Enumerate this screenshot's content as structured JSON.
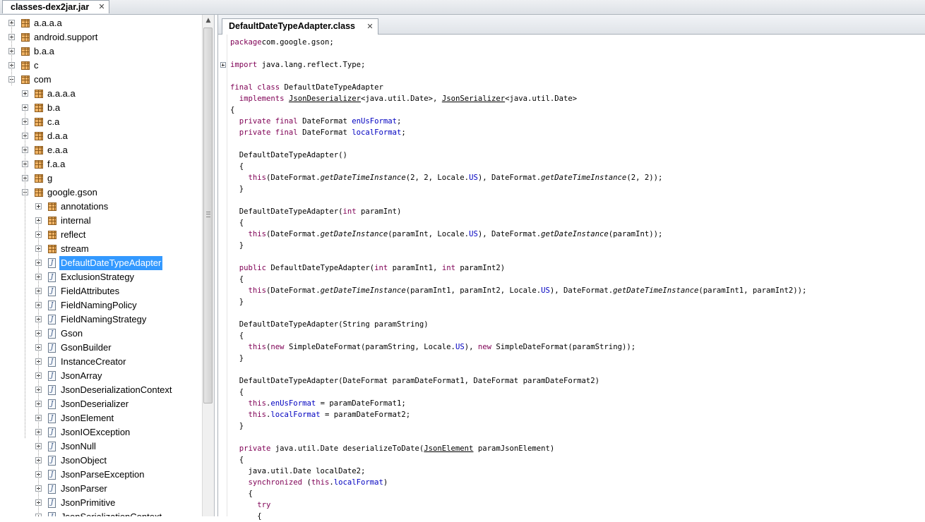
{
  "window": {
    "top_tab": "classes-dex2jar.jar"
  },
  "tree": [
    {
      "label": "a.a.a.a",
      "kind": "package",
      "level": 0,
      "expanded": false
    },
    {
      "label": "android.support",
      "kind": "package",
      "level": 0,
      "expanded": false
    },
    {
      "label": "b.a.a",
      "kind": "package",
      "level": 0,
      "expanded": false
    },
    {
      "label": "c",
      "kind": "package",
      "level": 0,
      "expanded": false
    },
    {
      "label": "com",
      "kind": "package",
      "level": 0,
      "expanded": true
    },
    {
      "label": "a.a.a.a",
      "kind": "package",
      "level": 1,
      "expanded": false
    },
    {
      "label": "b.a",
      "kind": "package",
      "level": 1,
      "expanded": false
    },
    {
      "label": "c.a",
      "kind": "package",
      "level": 1,
      "expanded": false
    },
    {
      "label": "d.a.a",
      "kind": "package",
      "level": 1,
      "expanded": false
    },
    {
      "label": "e.a.a",
      "kind": "package",
      "level": 1,
      "expanded": false
    },
    {
      "label": "f.a.a",
      "kind": "package",
      "level": 1,
      "expanded": false
    },
    {
      "label": "g",
      "kind": "package",
      "level": 1,
      "expanded": false
    },
    {
      "label": "google.gson",
      "kind": "package",
      "level": 1,
      "expanded": true
    },
    {
      "label": "annotations",
      "kind": "package",
      "level": 2,
      "expanded": false
    },
    {
      "label": "internal",
      "kind": "package",
      "level": 2,
      "expanded": false
    },
    {
      "label": "reflect",
      "kind": "package",
      "level": 2,
      "expanded": false
    },
    {
      "label": "stream",
      "kind": "package",
      "level": 2,
      "expanded": false
    },
    {
      "label": "DefaultDateTypeAdapter",
      "kind": "class",
      "level": 2,
      "expanded": false,
      "selected": true
    },
    {
      "label": "ExclusionStrategy",
      "kind": "class",
      "level": 2,
      "expanded": false
    },
    {
      "label": "FieldAttributes",
      "kind": "class",
      "level": 2,
      "expanded": false
    },
    {
      "label": "FieldNamingPolicy",
      "kind": "class",
      "level": 2,
      "expanded": false
    },
    {
      "label": "FieldNamingStrategy",
      "kind": "class",
      "level": 2,
      "expanded": false
    },
    {
      "label": "Gson",
      "kind": "class",
      "level": 2,
      "expanded": false
    },
    {
      "label": "GsonBuilder",
      "kind": "class",
      "level": 2,
      "expanded": false
    },
    {
      "label": "InstanceCreator",
      "kind": "class",
      "level": 2,
      "expanded": false
    },
    {
      "label": "JsonArray",
      "kind": "class",
      "level": 2,
      "expanded": false
    },
    {
      "label": "JsonDeserializationContext",
      "kind": "class",
      "level": 2,
      "expanded": false
    },
    {
      "label": "JsonDeserializer",
      "kind": "class",
      "level": 2,
      "expanded": false
    },
    {
      "label": "JsonElement",
      "kind": "class",
      "level": 2,
      "expanded": false
    },
    {
      "label": "JsonIOException",
      "kind": "class",
      "level": 2,
      "expanded": false
    },
    {
      "label": "JsonNull",
      "kind": "class",
      "level": 2,
      "expanded": false
    },
    {
      "label": "JsonObject",
      "kind": "class",
      "level": 2,
      "expanded": false
    },
    {
      "label": "JsonParseException",
      "kind": "class",
      "level": 2,
      "expanded": false
    },
    {
      "label": "JsonParser",
      "kind": "class",
      "level": 2,
      "expanded": false
    },
    {
      "label": "JsonPrimitive",
      "kind": "class",
      "level": 2,
      "expanded": false
    },
    {
      "label": "JsonSerializationContext",
      "kind": "class",
      "level": 2,
      "expanded": false
    }
  ],
  "editor": {
    "tab_label": "DefaultDateTypeAdapter.class",
    "code_lines": [
      {
        "row": 0,
        "segments": [
          [
            "kw",
            "package"
          ],
          [
            "",
            "com.google.gson;"
          ]
        ]
      },
      {
        "row": 2,
        "fold": true,
        "segments": [
          [
            "kw",
            "import"
          ],
          [
            "",
            " java.lang.reflect.Type;"
          ]
        ]
      },
      {
        "row": 4,
        "segments": [
          [
            "kw",
            "final class"
          ],
          [
            "",
            " DefaultDateTypeAdapter"
          ]
        ]
      },
      {
        "row": 5,
        "segments": [
          [
            "",
            "  "
          ],
          [
            "kw",
            "implements"
          ],
          [
            "",
            " "
          ],
          [
            "typ",
            "JsonDeserializer"
          ],
          [
            "",
            "<java.util.Date>, "
          ],
          [
            "typ",
            "JsonSerializer"
          ],
          [
            "",
            "<java.util.Date>"
          ]
        ]
      },
      {
        "row": 6,
        "segments": [
          [
            "",
            "{"
          ]
        ]
      },
      {
        "row": 7,
        "segments": [
          [
            "",
            "  "
          ],
          [
            "kw",
            "private final"
          ],
          [
            "",
            " DateFormat "
          ],
          [
            "fld",
            "enUsFormat"
          ],
          [
            "",
            ";"
          ]
        ]
      },
      {
        "row": 8,
        "segments": [
          [
            "",
            "  "
          ],
          [
            "kw",
            "private final"
          ],
          [
            "",
            " DateFormat "
          ],
          [
            "fld",
            "localFormat"
          ],
          [
            "",
            ";"
          ]
        ]
      },
      {
        "row": 10,
        "segments": [
          [
            "",
            "  DefaultDateTypeAdapter()"
          ]
        ]
      },
      {
        "row": 11,
        "segments": [
          [
            "",
            "  {"
          ]
        ]
      },
      {
        "row": 12,
        "segments": [
          [
            "",
            "    "
          ],
          [
            "kw",
            "this"
          ],
          [
            "",
            "(DateFormat."
          ],
          [
            "mth",
            "getDateTimeInstance"
          ],
          [
            "",
            "(2, 2, Locale."
          ],
          [
            "fld",
            "US"
          ],
          [
            "",
            "), DateFormat."
          ],
          [
            "mth",
            "getDateTimeInstance"
          ],
          [
            "",
            "(2, 2));"
          ]
        ]
      },
      {
        "row": 13,
        "segments": [
          [
            "",
            "  }"
          ]
        ]
      },
      {
        "row": 15,
        "segments": [
          [
            "",
            "  DefaultDateTypeAdapter("
          ],
          [
            "kw",
            "int"
          ],
          [
            "",
            " paramInt)"
          ]
        ]
      },
      {
        "row": 16,
        "segments": [
          [
            "",
            "  {"
          ]
        ]
      },
      {
        "row": 17,
        "segments": [
          [
            "",
            "    "
          ],
          [
            "kw",
            "this"
          ],
          [
            "",
            "(DateFormat."
          ],
          [
            "mth",
            "getDateInstance"
          ],
          [
            "",
            "(paramInt, Locale."
          ],
          [
            "fld",
            "US"
          ],
          [
            "",
            "), DateFormat."
          ],
          [
            "mth",
            "getDateInstance"
          ],
          [
            "",
            "(paramInt));"
          ]
        ]
      },
      {
        "row": 18,
        "segments": [
          [
            "",
            "  }"
          ]
        ]
      },
      {
        "row": 20,
        "segments": [
          [
            "",
            "  "
          ],
          [
            "kw",
            "public"
          ],
          [
            "",
            " DefaultDateTypeAdapter("
          ],
          [
            "kw",
            "int"
          ],
          [
            "",
            " paramInt1, "
          ],
          [
            "kw",
            "int"
          ],
          [
            "",
            " paramInt2)"
          ]
        ]
      },
      {
        "row": 21,
        "segments": [
          [
            "",
            "  {"
          ]
        ]
      },
      {
        "row": 22,
        "segments": [
          [
            "",
            "    "
          ],
          [
            "kw",
            "this"
          ],
          [
            "",
            "(DateFormat."
          ],
          [
            "mth",
            "getDateTimeInstance"
          ],
          [
            "",
            "(paramInt1, paramInt2, Locale."
          ],
          [
            "fld",
            "US"
          ],
          [
            "",
            "), DateFormat."
          ],
          [
            "mth",
            "getDateTimeInstance"
          ],
          [
            "",
            "(paramInt1, paramInt2));"
          ]
        ]
      },
      {
        "row": 23,
        "segments": [
          [
            "",
            "  }"
          ]
        ]
      },
      {
        "row": 25,
        "segments": [
          [
            "",
            "  DefaultDateTypeAdapter(String paramString)"
          ]
        ]
      },
      {
        "row": 26,
        "segments": [
          [
            "",
            "  {"
          ]
        ]
      },
      {
        "row": 27,
        "segments": [
          [
            "",
            "    "
          ],
          [
            "kw",
            "this"
          ],
          [
            "",
            "("
          ],
          [
            "kw",
            "new"
          ],
          [
            "",
            " SimpleDateFormat(paramString, Locale."
          ],
          [
            "fld",
            "US"
          ],
          [
            "",
            "), "
          ],
          [
            "kw",
            "new"
          ],
          [
            "",
            " SimpleDateFormat(paramString));"
          ]
        ]
      },
      {
        "row": 28,
        "segments": [
          [
            "",
            "  }"
          ]
        ]
      },
      {
        "row": 30,
        "segments": [
          [
            "",
            "  DefaultDateTypeAdapter(DateFormat paramDateFormat1, DateFormat paramDateFormat2)"
          ]
        ]
      },
      {
        "row": 31,
        "segments": [
          [
            "",
            "  {"
          ]
        ]
      },
      {
        "row": 32,
        "segments": [
          [
            "",
            "    "
          ],
          [
            "kw",
            "this"
          ],
          [
            "",
            "."
          ],
          [
            "fld",
            "enUsFormat"
          ],
          [
            "",
            " = paramDateFormat1;"
          ]
        ]
      },
      {
        "row": 33,
        "segments": [
          [
            "",
            "    "
          ],
          [
            "kw",
            "this"
          ],
          [
            "",
            "."
          ],
          [
            "fld",
            "localFormat"
          ],
          [
            "",
            " = paramDateFormat2;"
          ]
        ]
      },
      {
        "row": 34,
        "segments": [
          [
            "",
            "  }"
          ]
        ]
      },
      {
        "row": 36,
        "segments": [
          [
            "",
            "  "
          ],
          [
            "kw",
            "private"
          ],
          [
            "",
            " java.util.Date deserializeToDate("
          ],
          [
            "typ",
            "JsonElement"
          ],
          [
            "",
            " paramJsonElement)"
          ]
        ]
      },
      {
        "row": 37,
        "segments": [
          [
            "",
            "  {"
          ]
        ]
      },
      {
        "row": 38,
        "segments": [
          [
            "",
            "    java.util.Date localDate2;"
          ]
        ]
      },
      {
        "row": 39,
        "segments": [
          [
            "",
            "    "
          ],
          [
            "kw",
            "synchronized"
          ],
          [
            "",
            " ("
          ],
          [
            "kw",
            "this"
          ],
          [
            "",
            "."
          ],
          [
            "fld",
            "localFormat"
          ],
          [
            "",
            ")"
          ]
        ]
      },
      {
        "row": 40,
        "segments": [
          [
            "",
            "    {"
          ]
        ]
      },
      {
        "row": 41,
        "segments": [
          [
            "",
            "      "
          ],
          [
            "kw",
            "try"
          ]
        ]
      },
      {
        "row": 42,
        "segments": [
          [
            "",
            "      {"
          ]
        ]
      }
    ]
  }
}
